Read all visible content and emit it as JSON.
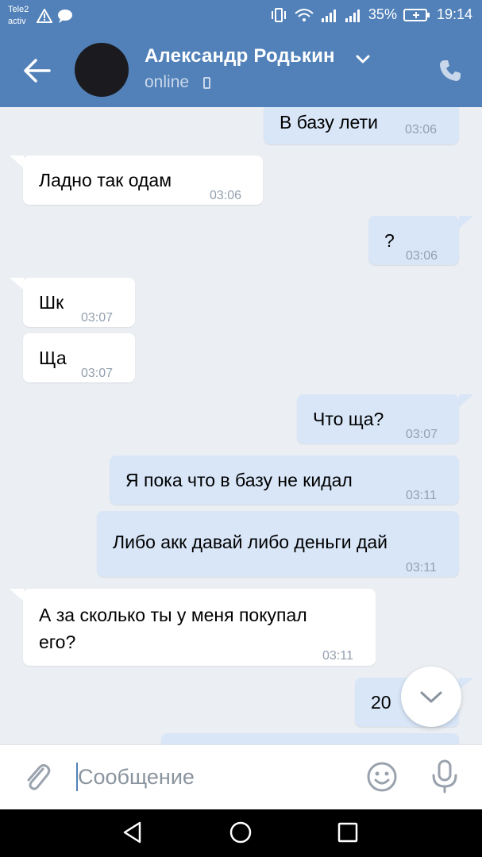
{
  "status_bar": {
    "carrier_line1": "Tele2",
    "carrier_line2": "activ",
    "battery": "35%",
    "time": "19:14",
    "icons": [
      "warning-icon",
      "chat-bubble-icon",
      "vibrate-icon",
      "wifi-icon",
      "signal-icon",
      "signal-icon",
      "battery-icon"
    ]
  },
  "header": {
    "name": "Александр Родькин",
    "status": "online",
    "colors": {
      "bar": "#5181b8"
    }
  },
  "messages": [
    {
      "dir": "out",
      "text": "В базу лети",
      "time": "03:06"
    },
    {
      "dir": "in",
      "text": "Ладно так одам",
      "time": "03:06"
    },
    {
      "dir": "out",
      "text": "?",
      "time": "03:06"
    },
    {
      "dir": "in",
      "text": "Шк",
      "time": "03:07"
    },
    {
      "dir": "in",
      "text": "Ща",
      "time": "03:07"
    },
    {
      "dir": "out",
      "text": "Что ща?",
      "time": "03:07"
    },
    {
      "dir": "out",
      "text": "Я пока что в базу не кидал",
      "time": "03:11"
    },
    {
      "dir": "out",
      "text": "Либо акк давай либо деньги дай",
      "time": "03:11"
    },
    {
      "dir": "in",
      "text_line1": "А за сколько ты у меня покупал",
      "text_line2": "его?",
      "time": "03:11"
    },
    {
      "dir": "out",
      "text": "20",
      "time": ""
    }
  ],
  "input": {
    "placeholder": "Сообщение"
  },
  "colors": {
    "incoming": "#ffffff",
    "outgoing": "#d8e6f8",
    "background": "#ebeef2",
    "accent": "#5181b8"
  }
}
